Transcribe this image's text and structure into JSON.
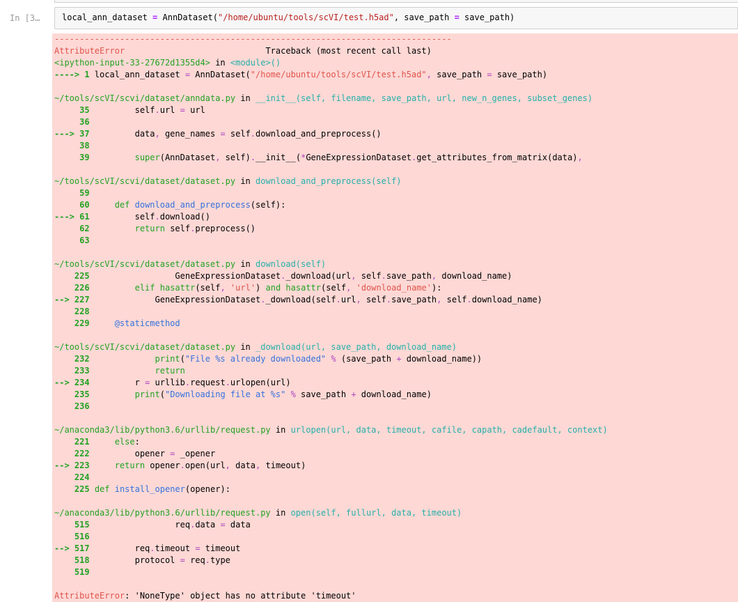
{
  "colors": {
    "k": "#000000",
    "r": "#e0544c",
    "g": "#22a222",
    "N": "#22a222",
    "t": "#26b0a9",
    "b": "#3572dd",
    "p": "#ae45c0",
    "O": "#aa22ff",
    "S": "#ba2121",
    "error_bg": "#fdd8d5",
    "input_bg": "#f7f7f7",
    "input_border": "#cfcfcf",
    "prompt": "#9a9a9a"
  },
  "cell": {
    "prompt": "In [3…",
    "input_lines": [
      [
        [
          "k",
          "local_ann_dataset "
        ],
        [
          "O",
          "="
        ],
        [
          "k",
          " AnnDataset("
        ],
        [
          "S",
          "\"/home/ubuntu/tools/scVI/test.h5ad\""
        ],
        [
          "k",
          ", save_path "
        ],
        [
          "O",
          "="
        ],
        [
          "k",
          " save_path)"
        ]
      ]
    ]
  },
  "traceback": {
    "lines": [
      [
        [
          "r",
          "-------------------------------------------------------------------------------"
        ]
      ],
      [
        [
          "r",
          "AttributeError"
        ],
        [
          "k",
          "                            Traceback (most recent call last)"
        ]
      ],
      [
        [
          "g",
          "<ipython-input-33-27672d1355d4>"
        ],
        [
          "k",
          " in "
        ],
        [
          "t",
          "<module>()"
        ]
      ],
      [
        [
          "N",
          "----> 1 "
        ],
        [
          "k",
          "local_ann_dataset "
        ],
        [
          "p",
          "="
        ],
        [
          "k",
          " AnnDataset("
        ],
        [
          "r",
          "\"/home/ubuntu/tools/scVI/test.h5ad\""
        ],
        [
          "p",
          ","
        ],
        [
          "k",
          " save_path "
        ],
        [
          "p",
          "="
        ],
        [
          "k",
          " save_path)"
        ]
      ],
      [],
      [
        [
          "g",
          "~/tools/scVI/scvi/dataset/anndata.py"
        ],
        [
          "k",
          " in "
        ],
        [
          "t",
          "__init__(self, filename, save_path, url, new_n_genes, subset_genes)"
        ]
      ],
      [
        [
          "N",
          "     35"
        ],
        [
          "k",
          "         self"
        ],
        [
          "p",
          "."
        ],
        [
          "k",
          "url "
        ],
        [
          "p",
          "="
        ],
        [
          "k",
          " url"
        ]
      ],
      [
        [
          "N",
          "     36"
        ],
        [
          "k",
          " "
        ]
      ],
      [
        [
          "N",
          "---> 37"
        ],
        [
          "k",
          "         data"
        ],
        [
          "p",
          ","
        ],
        [
          "k",
          " gene_names "
        ],
        [
          "p",
          "="
        ],
        [
          "k",
          " self"
        ],
        [
          "p",
          "."
        ],
        [
          "k",
          "download_and_preprocess()"
        ]
      ],
      [
        [
          "N",
          "     38"
        ],
        [
          "k",
          " "
        ]
      ],
      [
        [
          "N",
          "     39"
        ],
        [
          "k",
          "         "
        ],
        [
          "g",
          "super"
        ],
        [
          "k",
          "(AnnDataset"
        ],
        [
          "p",
          ","
        ],
        [
          "k",
          " self)"
        ],
        [
          "p",
          "."
        ],
        [
          "k",
          "__init__("
        ],
        [
          "p",
          "*"
        ],
        [
          "k",
          "GeneExpressionDataset"
        ],
        [
          "p",
          "."
        ],
        [
          "k",
          "get_attributes_from_matrix(data)"
        ],
        [
          "p",
          ","
        ]
      ],
      [],
      [
        [
          "g",
          "~/tools/scVI/scvi/dataset/dataset.py"
        ],
        [
          "k",
          " in "
        ],
        [
          "t",
          "download_and_preprocess(self)"
        ]
      ],
      [
        [
          "N",
          "     59"
        ],
        [
          "k",
          " "
        ]
      ],
      [
        [
          "N",
          "     60"
        ],
        [
          "k",
          "     "
        ],
        [
          "g",
          "def"
        ],
        [
          "k",
          " "
        ],
        [
          "b",
          "download_and_preprocess"
        ],
        [
          "k",
          "(self):"
        ]
      ],
      [
        [
          "N",
          "---> 61"
        ],
        [
          "k",
          "         self"
        ],
        [
          "p",
          "."
        ],
        [
          "k",
          "download()"
        ]
      ],
      [
        [
          "N",
          "     62"
        ],
        [
          "k",
          "         "
        ],
        [
          "g",
          "return"
        ],
        [
          "k",
          " self"
        ],
        [
          "p",
          "."
        ],
        [
          "k",
          "preprocess()"
        ]
      ],
      [
        [
          "N",
          "     63"
        ],
        [
          "k",
          " "
        ]
      ],
      [],
      [
        [
          "g",
          "~/tools/scVI/scvi/dataset/dataset.py"
        ],
        [
          "k",
          " in "
        ],
        [
          "t",
          "download(self)"
        ]
      ],
      [
        [
          "N",
          "    225"
        ],
        [
          "k",
          "                 GeneExpressionDataset"
        ],
        [
          "p",
          "."
        ],
        [
          "k",
          "_download(url"
        ],
        [
          "p",
          ","
        ],
        [
          "k",
          " self"
        ],
        [
          "p",
          "."
        ],
        [
          "k",
          "save_path"
        ],
        [
          "p",
          ","
        ],
        [
          "k",
          " download_name)"
        ]
      ],
      [
        [
          "N",
          "    226"
        ],
        [
          "k",
          "         "
        ],
        [
          "g",
          "elif"
        ],
        [
          "k",
          " "
        ],
        [
          "g",
          "hasattr"
        ],
        [
          "k",
          "(self"
        ],
        [
          "p",
          ","
        ],
        [
          "k",
          " "
        ],
        [
          "r",
          "'url'"
        ],
        [
          "k",
          ") "
        ],
        [
          "g",
          "and"
        ],
        [
          "k",
          " "
        ],
        [
          "g",
          "hasattr"
        ],
        [
          "k",
          "(self"
        ],
        [
          "p",
          ","
        ],
        [
          "k",
          " "
        ],
        [
          "r",
          "'download_name'"
        ],
        [
          "k",
          "):"
        ]
      ],
      [
        [
          "N",
          "--> 227"
        ],
        [
          "k",
          "             GeneExpressionDataset"
        ],
        [
          "p",
          "."
        ],
        [
          "k",
          "_download(self"
        ],
        [
          "p",
          "."
        ],
        [
          "k",
          "url"
        ],
        [
          "p",
          ","
        ],
        [
          "k",
          " self"
        ],
        [
          "p",
          "."
        ],
        [
          "k",
          "save_path"
        ],
        [
          "p",
          ","
        ],
        [
          "k",
          " self"
        ],
        [
          "p",
          "."
        ],
        [
          "k",
          "download_name)"
        ]
      ],
      [
        [
          "N",
          "    228"
        ],
        [
          "k",
          " "
        ]
      ],
      [
        [
          "N",
          "    229"
        ],
        [
          "k",
          "     "
        ],
        [
          "b",
          "@staticmethod"
        ]
      ],
      [],
      [
        [
          "g",
          "~/tools/scVI/scvi/dataset/dataset.py"
        ],
        [
          "k",
          " in "
        ],
        [
          "t",
          "_download(url, save_path, download_name)"
        ]
      ],
      [
        [
          "N",
          "    232"
        ],
        [
          "k",
          "             "
        ],
        [
          "g",
          "print"
        ],
        [
          "k",
          "("
        ],
        [
          "b",
          "\"File %s already downloaded\""
        ],
        [
          "k",
          " "
        ],
        [
          "p",
          "%"
        ],
        [
          "k",
          " (save_path "
        ],
        [
          "p",
          "+"
        ],
        [
          "k",
          " download_name))"
        ]
      ],
      [
        [
          "N",
          "    233"
        ],
        [
          "k",
          "             "
        ],
        [
          "g",
          "return"
        ]
      ],
      [
        [
          "N",
          "--> 234"
        ],
        [
          "k",
          "         r "
        ],
        [
          "p",
          "="
        ],
        [
          "k",
          " urllib"
        ],
        [
          "p",
          "."
        ],
        [
          "k",
          "request"
        ],
        [
          "p",
          "."
        ],
        [
          "k",
          "urlopen(url)"
        ]
      ],
      [
        [
          "N",
          "    235"
        ],
        [
          "k",
          "         "
        ],
        [
          "g",
          "print"
        ],
        [
          "k",
          "("
        ],
        [
          "b",
          "\"Downloading file at %s\""
        ],
        [
          "k",
          " "
        ],
        [
          "p",
          "%"
        ],
        [
          "k",
          " save_path "
        ],
        [
          "p",
          "+"
        ],
        [
          "k",
          " download_name)"
        ]
      ],
      [
        [
          "N",
          "    236"
        ],
        [
          "k",
          " "
        ]
      ],
      [],
      [
        [
          "g",
          "~/anaconda3/lib/python3.6/urllib/request.py"
        ],
        [
          "k",
          " in "
        ],
        [
          "t",
          "urlopen(url, data, timeout, cafile, capath, cadefault, context)"
        ]
      ],
      [
        [
          "N",
          "    221"
        ],
        [
          "k",
          "     "
        ],
        [
          "g",
          "else"
        ],
        [
          "k",
          ":"
        ]
      ],
      [
        [
          "N",
          "    222"
        ],
        [
          "k",
          "         opener "
        ],
        [
          "p",
          "="
        ],
        [
          "k",
          " _opener"
        ]
      ],
      [
        [
          "N",
          "--> 223"
        ],
        [
          "k",
          "     "
        ],
        [
          "g",
          "return"
        ],
        [
          "k",
          " opener"
        ],
        [
          "p",
          "."
        ],
        [
          "k",
          "open(url"
        ],
        [
          "p",
          ","
        ],
        [
          "k",
          " data"
        ],
        [
          "p",
          ","
        ],
        [
          "k",
          " timeout)"
        ]
      ],
      [
        [
          "N",
          "    224"
        ],
        [
          "k",
          " "
        ]
      ],
      [
        [
          "N",
          "    225"
        ],
        [
          "k",
          " "
        ],
        [
          "g",
          "def"
        ],
        [
          "k",
          " "
        ],
        [
          "b",
          "install_opener"
        ],
        [
          "k",
          "(opener):"
        ]
      ],
      [],
      [
        [
          "g",
          "~/anaconda3/lib/python3.6/urllib/request.py"
        ],
        [
          "k",
          " in "
        ],
        [
          "t",
          "open(self, fullurl, data, timeout)"
        ]
      ],
      [
        [
          "N",
          "    515"
        ],
        [
          "k",
          "                 req"
        ],
        [
          "p",
          "."
        ],
        [
          "k",
          "data "
        ],
        [
          "p",
          "="
        ],
        [
          "k",
          " data"
        ]
      ],
      [
        [
          "N",
          "    516"
        ],
        [
          "k",
          " "
        ]
      ],
      [
        [
          "N",
          "--> 517"
        ],
        [
          "k",
          "         req"
        ],
        [
          "p",
          "."
        ],
        [
          "k",
          "timeout "
        ],
        [
          "p",
          "="
        ],
        [
          "k",
          " timeout"
        ]
      ],
      [
        [
          "N",
          "    518"
        ],
        [
          "k",
          "         protocol "
        ],
        [
          "p",
          "="
        ],
        [
          "k",
          " req"
        ],
        [
          "p",
          "."
        ],
        [
          "k",
          "type"
        ]
      ],
      [
        [
          "N",
          "    519"
        ],
        [
          "k",
          " "
        ]
      ],
      [],
      [
        [
          "r",
          "AttributeError"
        ],
        [
          "k",
          ": 'NoneType' object has no attribute 'timeout'"
        ]
      ]
    ]
  }
}
